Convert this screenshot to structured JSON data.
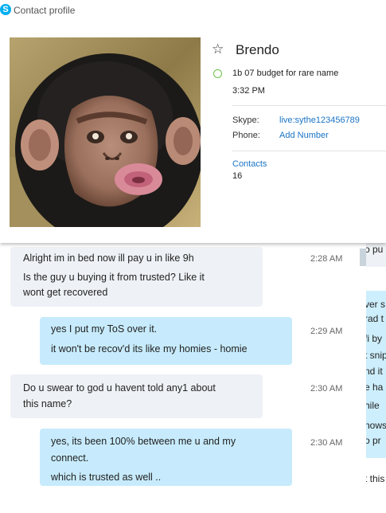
{
  "window": {
    "title": "Contact profile",
    "logo_letter": "S"
  },
  "profile": {
    "name": "Brendo",
    "mood": "1b 07 budget for rare name",
    "local_time": "3:32 PM",
    "skype_label": "Skype:",
    "skype_id": "live:sythe123456789",
    "phone_label": "Phone:",
    "phone_action": "Add Number",
    "contacts_label": "Contacts",
    "contacts_count": "16",
    "status_color": "#6cc04a",
    "link_color": "#1a74c5"
  },
  "messages": [
    {
      "direction": "in",
      "lines": [
        "Alright im in bed now ill pay u in like 9h",
        "Is the guy u buying it from trusted? Like it",
        "wont get recovered"
      ],
      "time": "2:28 AM"
    },
    {
      "direction": "out",
      "lines": [
        "yes I put my ToS over it.",
        "it won't be recov'd its like my homies - homie"
      ],
      "time": "2:29 AM"
    },
    {
      "direction": "in",
      "lines": [
        "Do u swear to god u havent told any1 about",
        "this name?"
      ],
      "time": "2:30 AM"
    },
    {
      "direction": "out",
      "lines": [
        "yes, its been 100% between me u and my",
        "connect.",
        "which is trusted as well .."
      ],
      "time": "2:30 AM"
    }
  ],
  "side_fragments": [
    "o pu",
    "ver s",
    "rad t",
    "fi by",
    "t snip",
    "nd it",
    "e ha",
    "hile",
    "nows",
    "o pr",
    "t this"
  ],
  "colors": {
    "incoming_bubble": "#eef1f5",
    "outgoing_bubble": "#c7ebfc",
    "skype_blue": "#00aff0"
  }
}
